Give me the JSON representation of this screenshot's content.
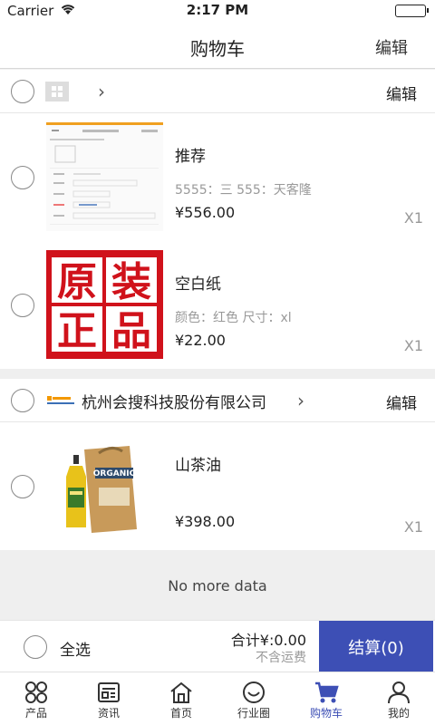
{
  "status": {
    "carrier": "Carrier",
    "time": "2:17 PM"
  },
  "nav": {
    "title": "购物车",
    "edit": "编辑"
  },
  "shops": [
    {
      "name": "",
      "edit": "编辑",
      "items": [
        {
          "title": "推荐",
          "spec": "5555：三 555：天客隆",
          "price": "¥556.00",
          "qty": "X1"
        },
        {
          "title": "空白纸",
          "spec": "颜色：红色 尺寸：xl",
          "price": "¥22.00",
          "qty": "X1",
          "image_text": [
            "原",
            "装",
            "正",
            "品"
          ]
        }
      ]
    },
    {
      "name": "杭州会搜科技股份有限公司",
      "edit": "编辑",
      "items": [
        {
          "title": "山茶油",
          "spec": "",
          "price": "¥398.00",
          "qty": "X1",
          "image_text": "ORGANIC"
        }
      ]
    }
  ],
  "no_more": "No more data",
  "footer": {
    "select_all": "全选",
    "total": "合计¥:0.00",
    "shipping": "不含运费",
    "checkout": "结算(0)"
  },
  "tabs": [
    {
      "label": "产品",
      "icon": "grid-icon"
    },
    {
      "label": "资讯",
      "icon": "news-icon"
    },
    {
      "label": "首页",
      "icon": "home-icon"
    },
    {
      "label": "行业圈",
      "icon": "smile-icon"
    },
    {
      "label": "购物车",
      "icon": "cart-icon",
      "active": true
    },
    {
      "label": "我的",
      "icon": "user-icon"
    }
  ],
  "colors": {
    "accent": "#3d4fb5",
    "red_banner": "#d0121b"
  }
}
